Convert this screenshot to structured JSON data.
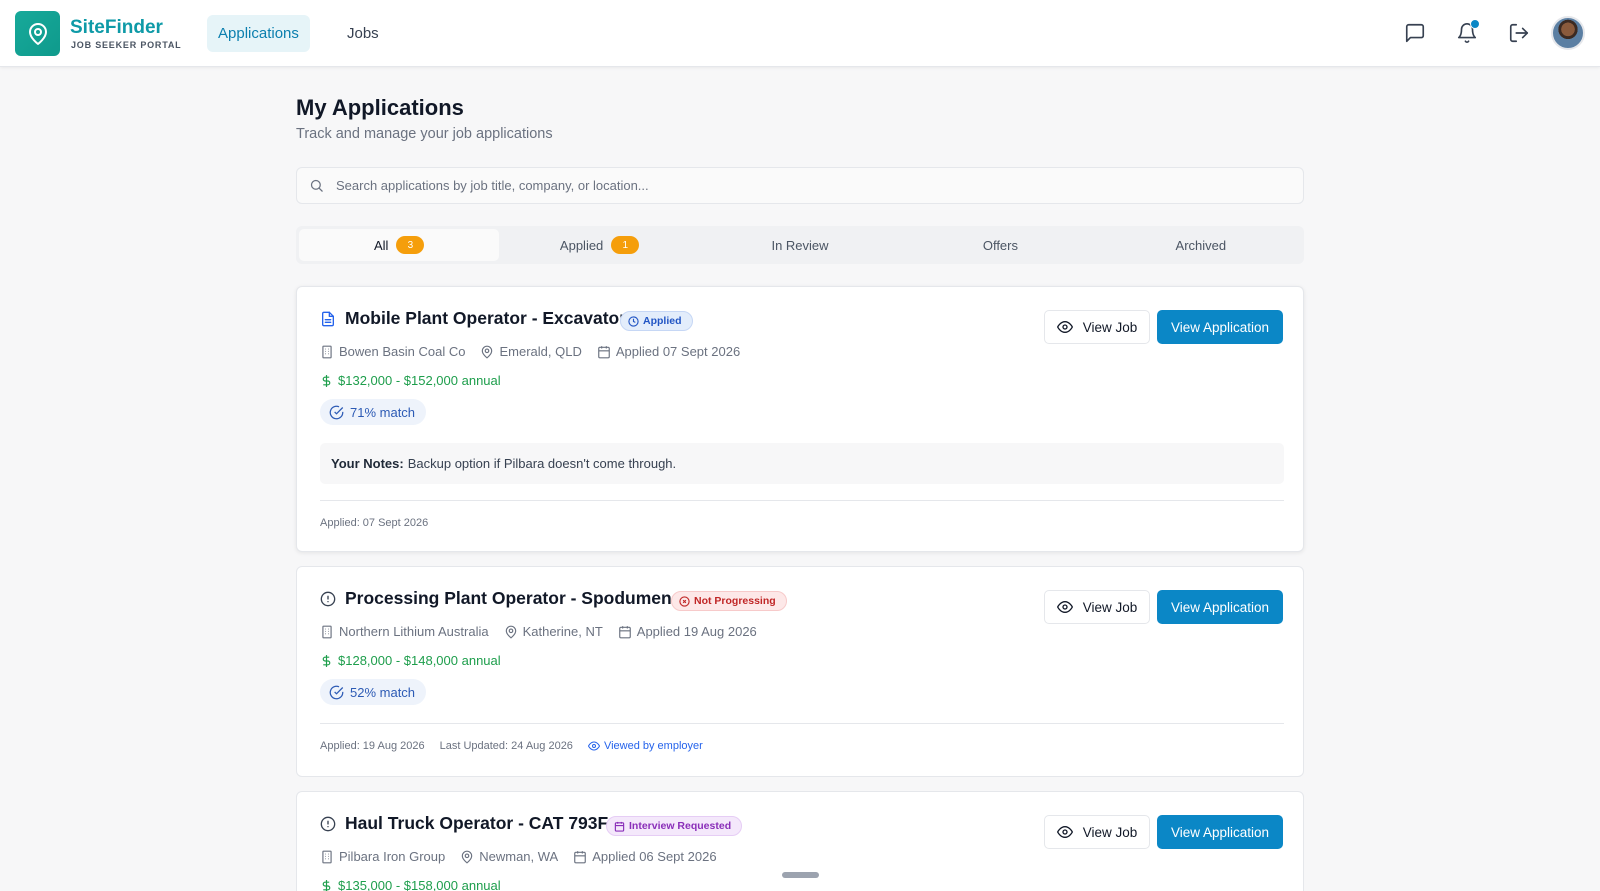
{
  "brand": {
    "name": "SiteFinder",
    "subtitle": "JOB SEEKER PORTAL"
  },
  "nav": {
    "tabs": [
      "Applications",
      "Jobs"
    ],
    "active": "Applications"
  },
  "header_icons": [
    "message-square-icon",
    "bell-icon",
    "logout-icon",
    "avatar"
  ],
  "page": {
    "title": "My Applications",
    "subtitle": "Track and manage your job applications"
  },
  "search": {
    "placeholder": "Search applications by job title, company, or location..."
  },
  "filters": [
    {
      "label": "All",
      "count": "3"
    },
    {
      "label": "Applied",
      "count": "1"
    },
    {
      "label": "In Review"
    },
    {
      "label": "Offers"
    },
    {
      "label": "Archived"
    }
  ],
  "buttons": {
    "view_job": "View Job",
    "view_application": "View Application"
  },
  "applications": [
    {
      "title": "Mobile Plant Operator - Excavator",
      "status": "Applied",
      "company": "Bowen Basin Coal Co",
      "location": "Emerald, QLD",
      "applied": "Applied 07 Sept 2026",
      "salary": "$132,000 - $152,000 annual",
      "match": "71% match",
      "notes_label": "Your Notes:",
      "notes": "Backup option if Pilbara doesn't come through.",
      "footer_applied": "Applied: 07 Sept 2026"
    },
    {
      "title": "Processing Plant Operator - Spodumene",
      "status": "Not Progressing",
      "company": "Northern Lithium Australia",
      "location": "Katherine, NT",
      "applied": "Applied 19 Aug 2026",
      "salary": "$128,000 - $148,000 annual",
      "match": "52% match",
      "footer_applied": "Applied: 19 Aug 2026",
      "footer_updated": "Last Updated: 24 Aug 2026",
      "footer_viewed": "Viewed by employer"
    },
    {
      "title": "Haul Truck Operator - CAT 793F",
      "status": "Interview Requested",
      "company": "Pilbara Iron Group",
      "location": "Newman, WA",
      "applied": "Applied 06 Sept 2026",
      "salary": "$135,000 - $158,000 annual"
    }
  ],
  "colors": {
    "primary": "#0b87c6",
    "brand_teal": "#0e9aa7",
    "salary_green": "#1e9e4c",
    "badge_orange": "#f59e0b"
  }
}
